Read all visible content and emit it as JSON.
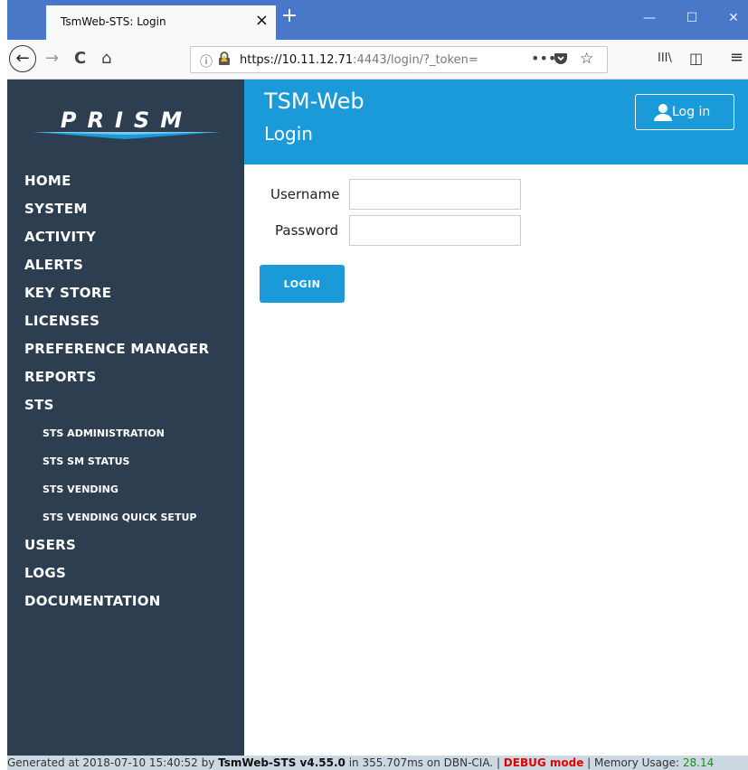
{
  "browser": {
    "tab_title": "TsmWeb-STS: Login",
    "tab_close": "×",
    "new_tab": "+",
    "url_host": "https://10.11.12.71",
    "url_rest": ":4443/login/?_token=",
    "url_more": "•••",
    "win_minimize": "—",
    "win_maximize": "☐",
    "win_close": "✕",
    "menu_icon": "≡",
    "library_icon": "III\\",
    "sidebar_icon": "◫",
    "reload_icon": "C",
    "home_icon": "⌂",
    "back_icon": "←",
    "forward_icon": "→",
    "info_icon": "ⓘ",
    "star_icon": "☆"
  },
  "header": {
    "title": "TSM-Web",
    "subtitle": "Login",
    "login_button": "Log in"
  },
  "sidebar": {
    "logo_text": "PRISM",
    "items": [
      {
        "label": "HOME",
        "sub": false
      },
      {
        "label": "SYSTEM",
        "sub": false
      },
      {
        "label": "ACTIVITY",
        "sub": false
      },
      {
        "label": "ALERTS",
        "sub": false
      },
      {
        "label": "KEY STORE",
        "sub": false
      },
      {
        "label": "LICENSES",
        "sub": false
      },
      {
        "label": "PREFERENCE MANAGER",
        "sub": false
      },
      {
        "label": "REPORTS",
        "sub": false
      },
      {
        "label": "STS",
        "sub": false
      },
      {
        "label": "STS ADMINISTRATION",
        "sub": true
      },
      {
        "label": "STS SM STATUS",
        "sub": true
      },
      {
        "label": "STS VENDING",
        "sub": true
      },
      {
        "label": "STS VENDING QUICK SETUP",
        "sub": true
      },
      {
        "label": "USERS",
        "sub": false
      },
      {
        "label": "LOGS",
        "sub": false
      },
      {
        "label": "DOCUMENTATION",
        "sub": false
      }
    ]
  },
  "form": {
    "username_label": "Username",
    "username_value": "",
    "password_label": "Password",
    "password_value": "",
    "submit_label": "LOGIN"
  },
  "footer": {
    "prefix": "Generated at 2018-07-10 15:40:52 by ",
    "app": "TsmWeb-STS v4.55.0",
    "middle": " in 355.707ms on DBN-CIA. | ",
    "debug": "DEBUG mode",
    "sep": " | Memory Usage: ",
    "memory": "28.14"
  },
  "colors": {
    "sidebar_bg": "#2c3e50",
    "accent": "#1b9ad9",
    "tabstrip": "#4a78c8"
  }
}
